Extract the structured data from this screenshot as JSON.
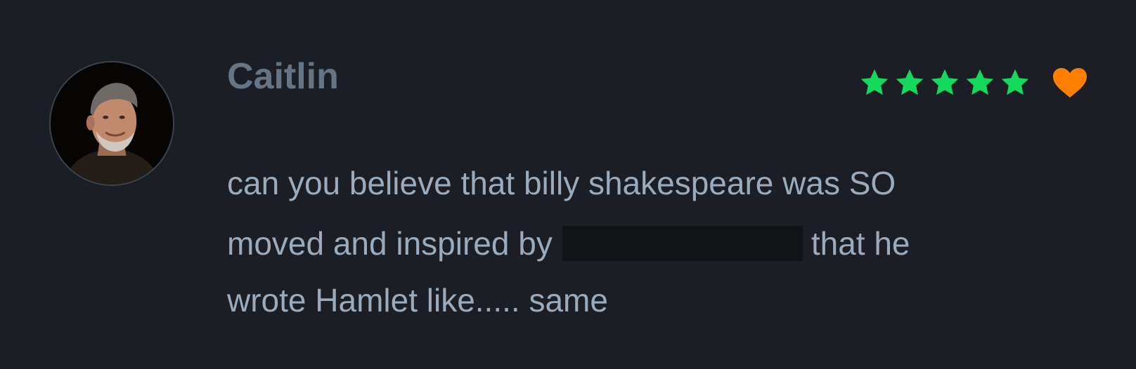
{
  "review": {
    "author": "Caitlin",
    "rating": 5,
    "rating_max": 5,
    "liked": true,
    "body_lines": [
      "can you believe that billy shakespeare was SO",
      "moved and inspired by",
      "that he",
      "wrote Hamlet like..... same"
    ],
    "colors": {
      "star": "#14d95a",
      "heart": "#ff8000",
      "author": "#667585",
      "body": "#9aabbd",
      "background": "#1b1e24"
    },
    "icons": {
      "avatar": "avatar-photo",
      "star": "star-icon",
      "like": "heart-icon"
    }
  }
}
